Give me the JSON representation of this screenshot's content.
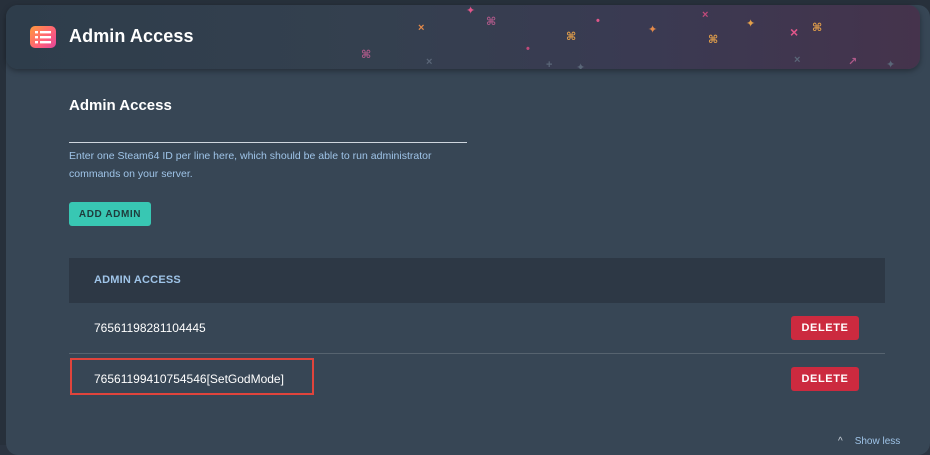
{
  "header": {
    "title": "Admin Access",
    "icon": "list-icon",
    "accent_colors": [
      "#ff9a3c",
      "#ff5f7a",
      "#e2459b"
    ]
  },
  "form": {
    "title": "Admin Access",
    "textarea_value": "",
    "hint": "Enter one Steam64 ID per line here, which should be able to run administrator commands on your server.",
    "add_button_label": "ADD ADMIN",
    "add_button_color": "#38c7b3"
  },
  "table": {
    "header": "ADMIN ACCESS",
    "rows": [
      {
        "id": "76561198281104445",
        "delete_label": "DELETE"
      },
      {
        "id": "76561199410754546[SetGodMode]",
        "delete_label": "DELETE"
      }
    ],
    "delete_color": "#cc2a3f"
  },
  "footer": {
    "show_less_label": "Show less",
    "chevron_icon": "chevron-up-icon"
  },
  "annotation": {
    "highlight_color": "#e0443c"
  }
}
